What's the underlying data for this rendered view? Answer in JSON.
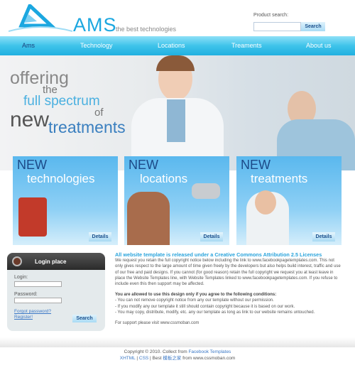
{
  "header": {
    "brand": "AMS",
    "tagline": "the best technologies",
    "search_label": "Product search:",
    "search_placeholder": "",
    "search_button": "Search"
  },
  "nav": [
    {
      "label": "Ams",
      "active": true
    },
    {
      "label": "Technology"
    },
    {
      "label": "Locations"
    },
    {
      "label": "Treaments"
    },
    {
      "label": "About us"
    }
  ],
  "hero": {
    "line1": "offering",
    "line2": "the",
    "line3": "full spectrum",
    "line4": "of",
    "line5": "new",
    "line6": "treatments"
  },
  "cards": [
    {
      "new": "NEW",
      "caption": "technologies",
      "button": "Details"
    },
    {
      "new": "NEW",
      "caption": "locations",
      "button": "Details"
    },
    {
      "new": "NEW",
      "caption": "treatments",
      "button": "Details"
    }
  ],
  "login": {
    "title": "Login place",
    "login_label": "Login:",
    "password_label": "Password:",
    "forgot": "Forgot password?",
    "register": "Register!",
    "button": "Search"
  },
  "content": {
    "title": "All website template is released under a Creative Commons Attribution 2.5 Licenses",
    "para": "We request you retain the full copyright notice below including the link to www.facebookpagetemplates.com. This not only gives respect to the large amount of time given freely by the developers but also helps build interest, traffic and use of our free and paid designs. If you cannot (for good reason) retain the full copyright we request you at least leave in place the Website Templates line, with Website Templates linked to www.facebookpagetemplates.com. If you refuse to include even this then support may be affected.",
    "cond_title": "You are allowed to use this design only if you agree to the following conditions:",
    "conds": [
      "- You can not remove copyright notice from any our template without our permission.",
      "- If you modify any our template it still should contain copyright because it is based on our work.",
      "- You may copy, distribute, modify, etc. any our template as long as link to our website remains untouched."
    ],
    "support": "For support please visit www.cssmoban.com"
  },
  "footer": {
    "copyright": "Copyright © 2010. Collect from",
    "fb_link": "Facebook Templates",
    "xhtml": "XHTML",
    "sep1": " | ",
    "css": "CSS",
    "best": " | Best ",
    "cn_link": "模板之家",
    "from": " from www.cssmoban.com"
  },
  "colors": {
    "accent": "#1ba7e0",
    "nav": "#3ec3ea",
    "active_nav": "#1c3f7a"
  }
}
